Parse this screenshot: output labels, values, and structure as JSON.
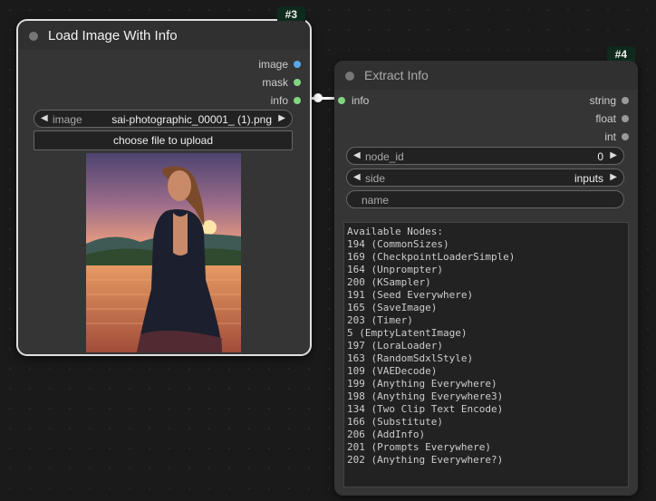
{
  "node3": {
    "badge": "#3",
    "title": "Load Image With Info",
    "outputs": [
      {
        "label": "image",
        "color": "#5aa6e8"
      },
      {
        "label": "mask",
        "color": "#7fd67f"
      },
      {
        "label": "info",
        "color": "#7fd67f"
      }
    ],
    "image_widget": {
      "label": "image",
      "value": "sai-photographic_00001_ (1).png"
    },
    "upload_button": "choose file to upload",
    "preview_icon": "photo-preview-woman-sunset"
  },
  "node4": {
    "badge": "#4",
    "title": "Extract Info",
    "inputs": [
      {
        "label": "info",
        "color": "#7fd67f"
      }
    ],
    "outputs": [
      {
        "label": "string",
        "color": "#9a9a9a"
      },
      {
        "label": "float",
        "color": "#9a9a9a"
      },
      {
        "label": "int",
        "color": "#9a9a9a"
      }
    ],
    "node_id_widget": {
      "label": "node_id",
      "value": "0"
    },
    "side_widget": {
      "label": "side",
      "value": "inputs"
    },
    "name_widget": {
      "label": "name"
    },
    "available_nodes": "Available Nodes:\n194 (CommonSizes)\n169 (CheckpointLoaderSimple)\n164 (Unprompter)\n200 (KSampler)\n191 (Seed Everywhere)\n165 (SaveImage)\n203 (Timer)\n5 (EmptyLatentImage)\n197 (LoraLoader)\n163 (RandomSdxlStyle)\n109 (VAEDecode)\n199 (Anything Everywhere)\n198 (Anything Everywhere3)\n134 (Two Clip Text Encode)\n166 (Substitute)\n206 (AddInfo)\n201 (Prompts Everywhere)\n202 (Anything Everywhere?)"
  },
  "colors": {
    "canvas": "#1a1a1a",
    "node": "#353535",
    "badge": "#0e2a1d",
    "link": "#ffffff"
  }
}
